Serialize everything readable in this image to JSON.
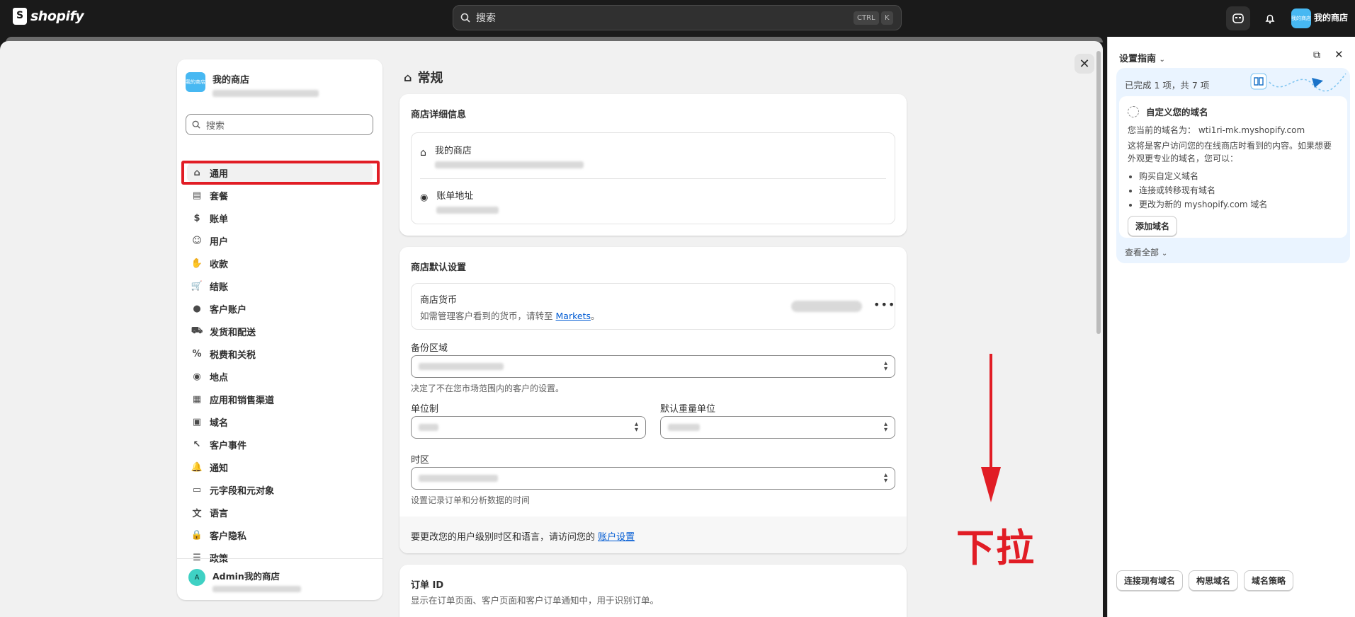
{
  "topbar": {
    "brand": "shopify",
    "search_placeholder": "搜索",
    "kbd_ctrl": "CTRL",
    "kbd_k": "K",
    "store_avatar_text": "我的商店",
    "store_name": "我的商店"
  },
  "nav": {
    "shop_name": "我的商店",
    "search_placeholder": "搜索",
    "items": [
      {
        "label": "通用",
        "icon": "store-icon"
      },
      {
        "label": "套餐",
        "icon": "plan-icon"
      },
      {
        "label": "账单",
        "icon": "billing-icon"
      },
      {
        "label": "用户",
        "icon": "users-icon"
      },
      {
        "label": "收款",
        "icon": "payments-icon"
      },
      {
        "label": "结账",
        "icon": "cart-icon"
      },
      {
        "label": "客户账户",
        "icon": "person-icon"
      },
      {
        "label": "发货和配送",
        "icon": "truck-icon"
      },
      {
        "label": "税费和关税",
        "icon": "tax-icon"
      },
      {
        "label": "地点",
        "icon": "location-icon"
      },
      {
        "label": "应用和销售渠道",
        "icon": "apps-icon"
      },
      {
        "label": "域名",
        "icon": "domain-icon"
      },
      {
        "label": "客户事件",
        "icon": "cursor-icon"
      },
      {
        "label": "通知",
        "icon": "bell-icon"
      },
      {
        "label": "元字段和元对象",
        "icon": "metafield-icon"
      },
      {
        "label": "语言",
        "icon": "language-icon"
      },
      {
        "label": "客户隐私",
        "icon": "lock-icon"
      },
      {
        "label": "政策",
        "icon": "policy-icon"
      }
    ],
    "admin_avatar": "A",
    "admin_name": "Admin我的商店"
  },
  "main": {
    "page_title": "常规",
    "store_details": {
      "heading": "商店详细信息",
      "store_name": "我的商店",
      "billing_address": "账单地址"
    },
    "defaults": {
      "heading": "商店默认设置",
      "currency_label": "商店货币",
      "currency_help": "如需管理客户看到的货币，请转至",
      "currency_link": "Markets",
      "currency_help_end": "。",
      "backup_region_label": "备份区域",
      "backup_region_help": "决定了不在您市场范围内的客户的设置。",
      "unit_system_label": "单位制",
      "weight_unit_label": "默认重量单位",
      "timezone_label": "时区",
      "timezone_help": "设置记录订单和分析数据的时间",
      "footer_text": "要更改您的用户级别时区和语言，请访问您的",
      "footer_link": "账户设置"
    },
    "order_id": {
      "heading": "订单 ID",
      "help": "显示在订单页面、客户页面和客户订单通知中，用于识别订单。"
    }
  },
  "annotation": "下拉",
  "panel": {
    "title": "设置指南",
    "progress": "已完成 1 项，共 7 项",
    "task_title": "自定义您的域名",
    "current_domain_prefix": "您当前的域名为：",
    "current_domain": "wti1ri-mk.myshopify.com",
    "task_desc": "这将是客户访问您的在线商店时看到的内容。如果想要外观更专业的域名，您可以：",
    "bullets": [
      "购买自定义域名",
      "连接或转移现有域名",
      "更改为新的 myshopify.com 域名"
    ],
    "add_domain": "添加域名",
    "view_all": "查看全部",
    "bottom_buttons": [
      "连接现有域名",
      "构思域名",
      "域名策略"
    ]
  }
}
